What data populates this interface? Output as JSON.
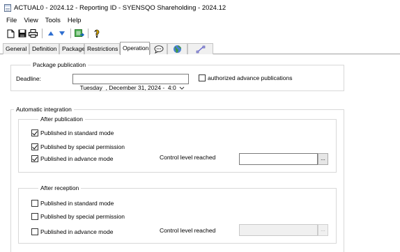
{
  "window": {
    "title": "ACTUAL0 - 2024.12 - Reporting ID - SYENSQO Shareholding - 2024.12"
  },
  "menu": [
    "File",
    "View",
    "Tools",
    "Help"
  ],
  "toolbar": {
    "buttons": [
      "new-document-icon",
      "save-icon",
      "print-icon",
      "arrow-up-icon",
      "arrow-down-icon",
      "export-icon",
      "help-icon"
    ]
  },
  "tabs": [
    {
      "label": "General",
      "active": false
    },
    {
      "label": "Definition",
      "active": false
    },
    {
      "label": "Package",
      "active": false
    },
    {
      "label": "Restrictions",
      "active": false
    },
    {
      "label": "Operation",
      "active": true
    },
    {
      "label": "",
      "icon": "speech-bubble-icon",
      "active": false
    },
    {
      "label": "",
      "icon": "globe-icon",
      "active": false
    },
    {
      "label": "",
      "icon": "link-tool-icon",
      "active": false
    }
  ],
  "package_publication": {
    "legend": "Package publication",
    "deadline_label": "Deadline:",
    "deadline_value": "Tuesday  , December 31, 2024 -  4:0",
    "authorized_advance": {
      "label": "authorized advance publications",
      "checked": false
    }
  },
  "automatic_integration": {
    "legend": "Automatic integration",
    "after_publication": {
      "legend": "After publication",
      "standard_mode": {
        "label": "Published in standard mode",
        "checked": true
      },
      "special_permission": {
        "label": "Published by special permission",
        "checked": true
      },
      "advance_mode": {
        "label": "Published in advance mode",
        "checked": true
      },
      "control_level_label": "Control level reached",
      "control_level_value": "",
      "browse_label": "..."
    },
    "after_reception": {
      "legend": "After reception",
      "standard_mode": {
        "label": "Published in standard mode",
        "checked": false
      },
      "special_permission": {
        "label": "Published by special permission",
        "checked": false
      },
      "advance_mode": {
        "label": "Published in advance mode",
        "checked": false
      },
      "control_level_label": "Control level reached",
      "control_level_value": "",
      "browse_label": "..."
    }
  },
  "colors": {
    "border": "#d8d8d8",
    "tab_border": "#a0a0a0",
    "arrow_blue": "#2f6fd0"
  }
}
